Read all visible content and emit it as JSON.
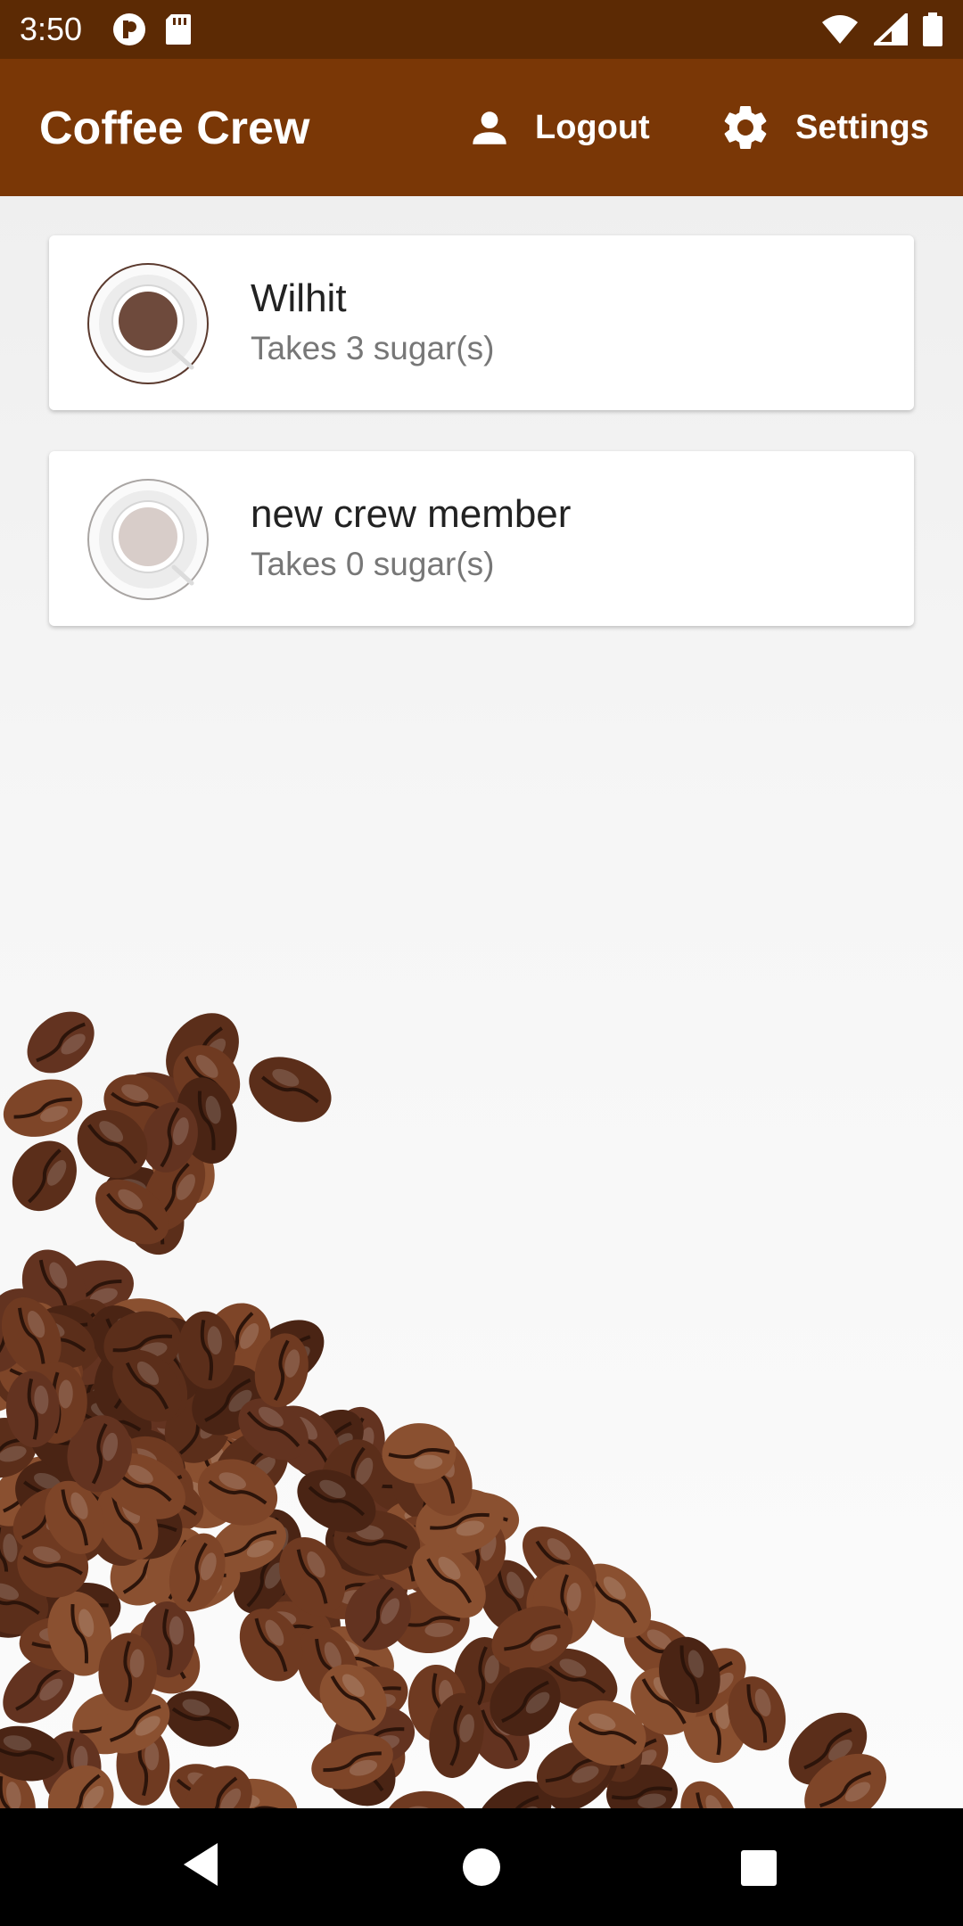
{
  "status_bar": {
    "time": "3:50",
    "icons_left": [
      "app-notification-icon",
      "sd-card-icon"
    ],
    "icons_right": [
      "wifi-icon",
      "cell-signal-icon",
      "battery-icon"
    ]
  },
  "app_bar": {
    "title": "Coffee Crew",
    "logout_label": "Logout",
    "settings_label": "Settings",
    "background_color": "#7a3706"
  },
  "crew": [
    {
      "name": "Wilhit",
      "subtitle": "Takes 3 sugar(s)",
      "cup_color": "#6e4a3c"
    },
    {
      "name": "new crew member",
      "subtitle": "Takes 0 sugar(s)",
      "cup_color": "#d8cdc9"
    }
  ],
  "nav_bar": {
    "buttons": [
      "back-icon",
      "home-icon",
      "recents-icon"
    ]
  }
}
